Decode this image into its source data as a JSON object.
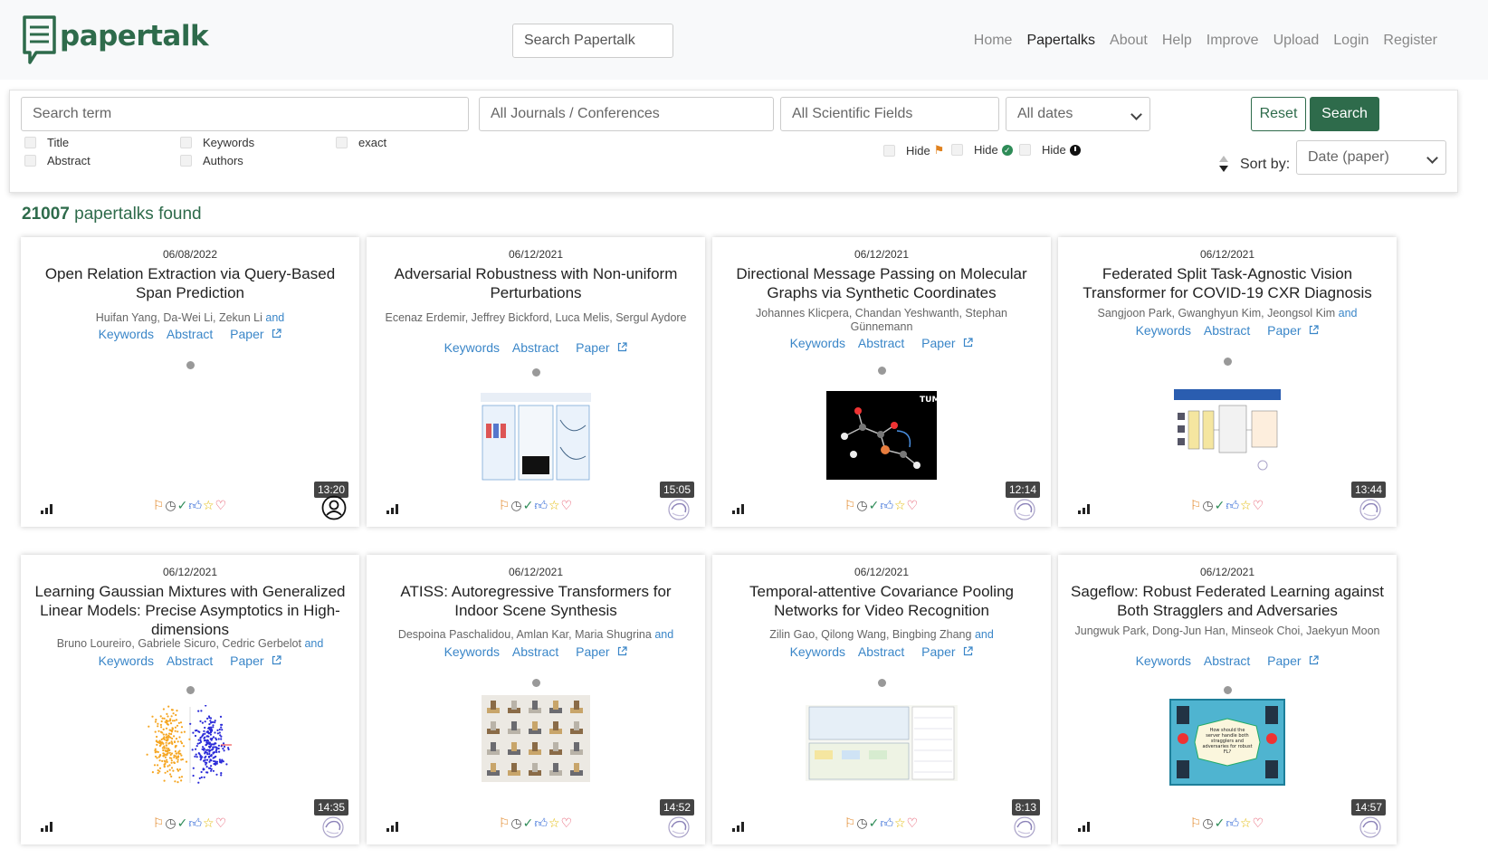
{
  "header": {
    "logo_text": "papertalk",
    "search_placeholder": "Search Papertalk",
    "nav": [
      {
        "label": "Home"
      },
      {
        "label": "Papertalks",
        "active": true
      },
      {
        "label": "About"
      },
      {
        "label": "Help"
      },
      {
        "label": "Improve"
      },
      {
        "label": "Upload"
      },
      {
        "label": "Login"
      },
      {
        "label": "Register"
      }
    ]
  },
  "filters": {
    "search_term_placeholder": "Search term",
    "journals": "All Journals / Conferences",
    "fields": "All Scientific Fields",
    "dates": "All dates",
    "reset_label": "Reset",
    "search_label": "Search",
    "checkboxes": {
      "title": "Title",
      "abstract": "Abstract",
      "keywords": "Keywords",
      "authors": "Authors",
      "exact": "exact"
    },
    "hide_label": "Hide",
    "sort_label": "Sort by:",
    "sort_value": "Date (paper)"
  },
  "results": {
    "count": "21007",
    "label": "papertalks found"
  },
  "card_links": {
    "keywords": "Keywords",
    "abstract": "Abstract",
    "paper": "Paper",
    "and": "and"
  },
  "cards": [
    {
      "date": "06/08/2022",
      "title": "Open Relation Extraction via Query-Based Span Prediction",
      "authors": "Huifan Yang, Da-Wei Li, Zekun Li",
      "and": true,
      "duration": "13:20",
      "thumb": "none"
    },
    {
      "date": "06/12/2021",
      "title": "Adversarial Robustness with Non-uniform Perturbations",
      "authors": "Ecenaz Erdemir, Jeffrey Bickford, Luca Melis, Sergul Aydore",
      "and": false,
      "duration": "15:05",
      "thumb": "poster-blue"
    },
    {
      "date": "06/12/2021",
      "title": "Directional Message Passing on Molecular Graphs via Synthetic Coordinates",
      "authors": "Johannes Klicpera, Chandan Yeshwanth, Stephan Günnemann",
      "and": false,
      "duration": "12:14",
      "thumb": "molecule"
    },
    {
      "date": "06/12/2021",
      "title": "Federated Split Task-Agnostic Vision Transformer for COVID-19 CXR Diagnosis",
      "authors": "Sangjoon Park, Gwanghyun Kim, Jeongsol Kim",
      "and": true,
      "duration": "13:44",
      "thumb": "diagram"
    },
    {
      "date": "06/12/2021",
      "title": "Learning Gaussian Mixtures with Generalized Linear Models: Precise Asymptotics in High-dimensions",
      "authors": "Bruno Loureiro, Gabriele Sicuro, Cedric Gerbelot",
      "and": true,
      "duration": "14:35",
      "thumb": "scatter"
    },
    {
      "date": "06/12/2021",
      "title": "ATISS: Autoregressive Transformers for Indoor Scene Synthesis",
      "authors": "Despoina Paschalidou, Amlan Kar, Maria Shugrina",
      "and": true,
      "duration": "14:52",
      "thumb": "rooms"
    },
    {
      "date": "06/12/2021",
      "title": "Temporal-attentive Covariance Pooling Networks for Video Recognition",
      "authors": "Zilin Gao, Qilong Wang, Bingbing Zhang",
      "and": true,
      "duration": "8:13",
      "thumb": "poster-light"
    },
    {
      "date": "06/12/2021",
      "title": "Sageflow: Robust Federated Learning against Both Stragglers and Adversaries",
      "authors": "Jungwuk Park, Dong-Jun Han, Minseok Choi, Jaekyun Moon",
      "and": false,
      "duration": "14:57",
      "thumb": "sageflow"
    }
  ],
  "thumb_texts": {
    "tum": "TUM",
    "sageflow": "How should the server handle both stragglers and adversaries for robust FL?"
  },
  "colors": {
    "brand": "#2e6b4b",
    "link": "#3a86c8",
    "flag": "#e0821f"
  }
}
